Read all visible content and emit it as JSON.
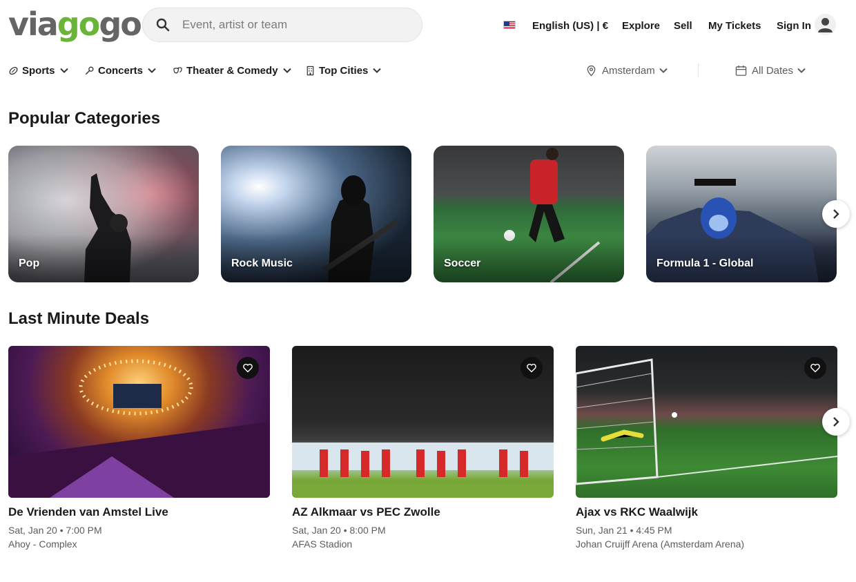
{
  "header": {
    "search": {
      "placeholder": "Event, artist or team",
      "value": ""
    },
    "language_label": "English (US) | €",
    "nav": {
      "explore": "Explore",
      "sell": "Sell",
      "my_tickets": "My Tickets",
      "sign_in": "Sign In"
    }
  },
  "category_nav": {
    "items": [
      {
        "label": "Sports",
        "icon": "football-icon"
      },
      {
        "label": "Concerts",
        "icon": "microphone-icon"
      },
      {
        "label": "Theater & Comedy",
        "icon": "masks-icon"
      },
      {
        "label": "Top Cities",
        "icon": "building-icon"
      }
    ],
    "location": "Amsterdam",
    "dates": "All Dates"
  },
  "popular_categories": {
    "title": "Popular Categories",
    "cards": [
      {
        "label": "Pop"
      },
      {
        "label": "Rock Music"
      },
      {
        "label": "Soccer"
      },
      {
        "label": "Formula 1 - Global"
      }
    ]
  },
  "last_minute_deals": {
    "title": "Last Minute Deals",
    "events": [
      {
        "name": "De Vrienden van Amstel Live",
        "date": "Sat, Jan 20 • 7:00 PM",
        "venue": "Ahoy - Complex"
      },
      {
        "name": "AZ Alkmaar vs PEC Zwolle",
        "date": "Sat, Jan 20 • 8:00 PM",
        "venue": "AFAS Stadion"
      },
      {
        "name": "Ajax vs RKC Waalwijk",
        "date": "Sun, Jan 21 • 4:45 PM",
        "venue": "Johan Cruijff Arena (Amsterdam Arena)"
      }
    ]
  },
  "colors": {
    "brand_green": "#6bb43a",
    "brand_gray": "#656565",
    "text": "#1a1a1a",
    "muted": "#5c5c5c"
  }
}
